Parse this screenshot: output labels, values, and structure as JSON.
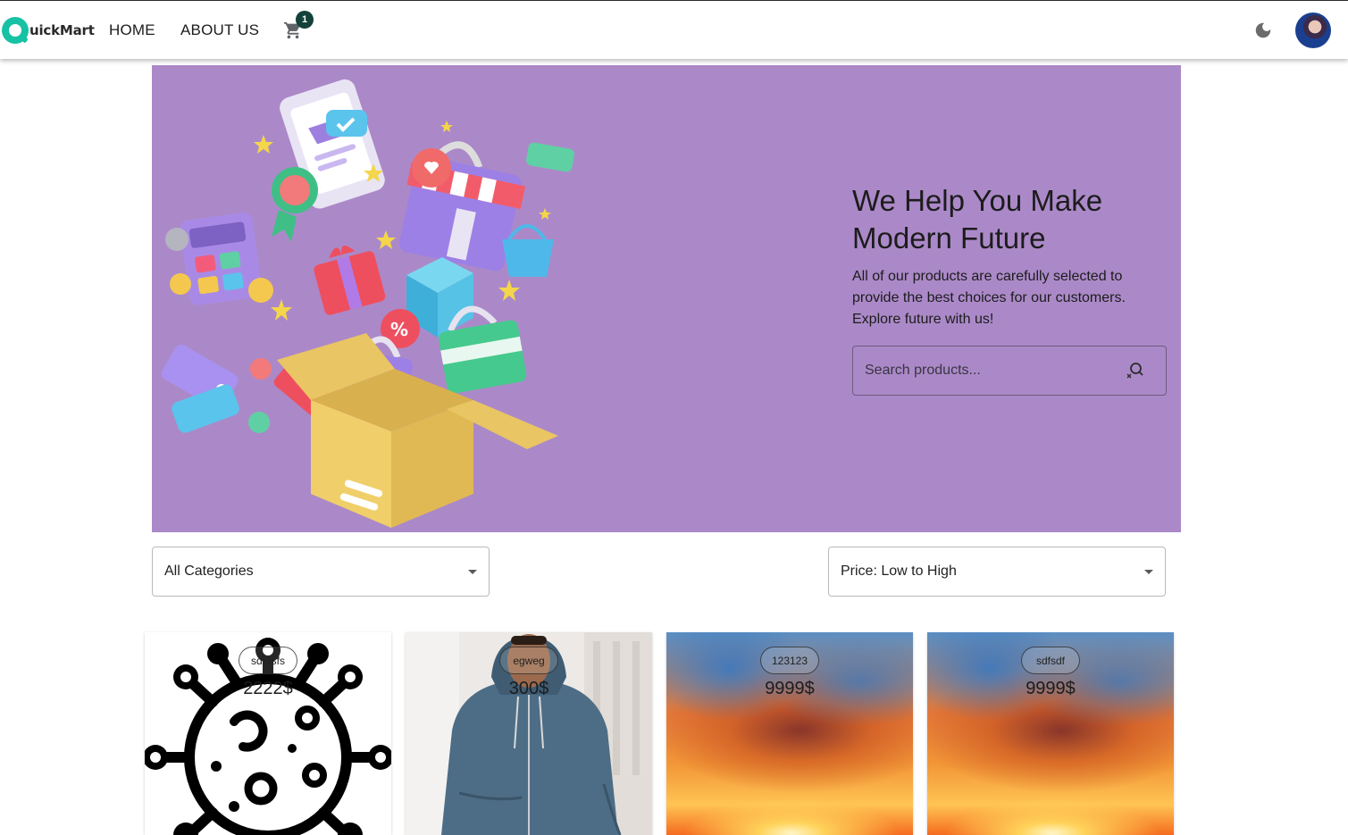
{
  "header": {
    "logo_text": "uickMart",
    "nav": {
      "home": "HOME",
      "about": "ABOUT US"
    },
    "cart_count": "1",
    "colors": {
      "brand": "#16c2a3",
      "badge": "#14423a"
    }
  },
  "hero": {
    "title": "We Help You Make Modern Future",
    "subtitle": "All of our products are carefully selected to provide the best choices for our customers. Explore future with us!",
    "search_placeholder": "Search products...",
    "background": "#ab89c8"
  },
  "filters": {
    "category": "All Categories",
    "sort": "Price: Low to High"
  },
  "products": [
    {
      "tag": "sdfdsfs",
      "price": "2222$"
    },
    {
      "tag": "egweg",
      "price": "300$"
    },
    {
      "tag": "123123",
      "price": "9999$"
    },
    {
      "tag": "sdfsdf",
      "price": "9999$"
    }
  ]
}
